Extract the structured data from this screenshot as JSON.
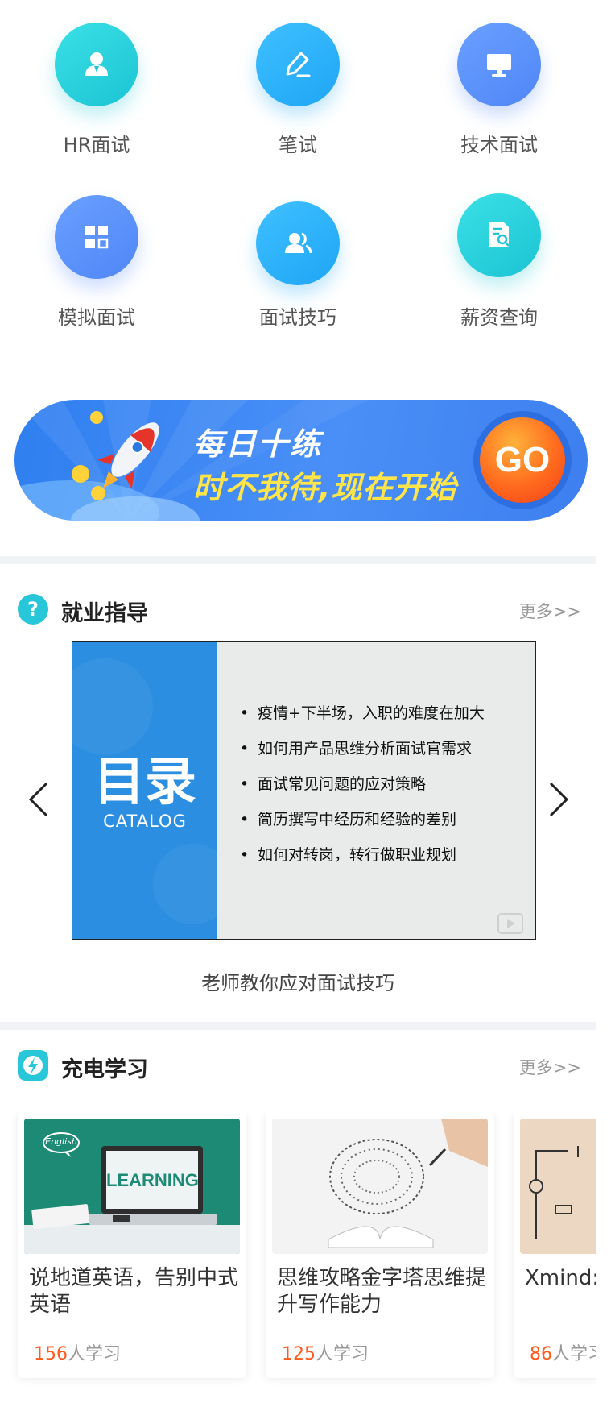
{
  "quick_entries": [
    {
      "label": "HR面试",
      "icon": "user-icon"
    },
    {
      "label": "笔试",
      "icon": "pen-icon"
    },
    {
      "label": "技术面试",
      "icon": "monitor-icon"
    },
    {
      "label": "模拟面试",
      "icon": "grid-icon"
    },
    {
      "label": "面试技巧",
      "icon": "people-icon"
    },
    {
      "label": "薪资查询",
      "icon": "document-search-icon"
    }
  ],
  "banner": {
    "title": "每日十练",
    "subtitle": "时不我待,现在开始",
    "go_label": "GO"
  },
  "guidance": {
    "title": "就业指导",
    "more": "更多>>",
    "slide": {
      "big_title": "目录",
      "catalog": "CATALOG",
      "items": [
        "疫情+下半场，入职的难度在加大",
        "如何用产品思维分析面试官需求",
        "面试常见问题的应对策略",
        "简历撰写中经历和经验的差别",
        "如何对转岗，转行做职业规划"
      ]
    },
    "caption": "老师教你应对面试技巧"
  },
  "study": {
    "title": "充电学习",
    "more": "更多>>",
    "count_suffix": "人学习",
    "courses": [
      {
        "title": "说地道英语，告别中式英语",
        "count": "156",
        "image_text": "LEARNING",
        "bubble_text": "English"
      },
      {
        "title": "思维攻略金字塔思维提升写作能力",
        "count": "125"
      },
      {
        "title": "Xmind:零基础",
        "count": "86"
      }
    ]
  },
  "colors": {
    "accent_orange": "#ff5a1f",
    "banner_blue": "#3d86f5",
    "teal": "#1bc4d4"
  }
}
